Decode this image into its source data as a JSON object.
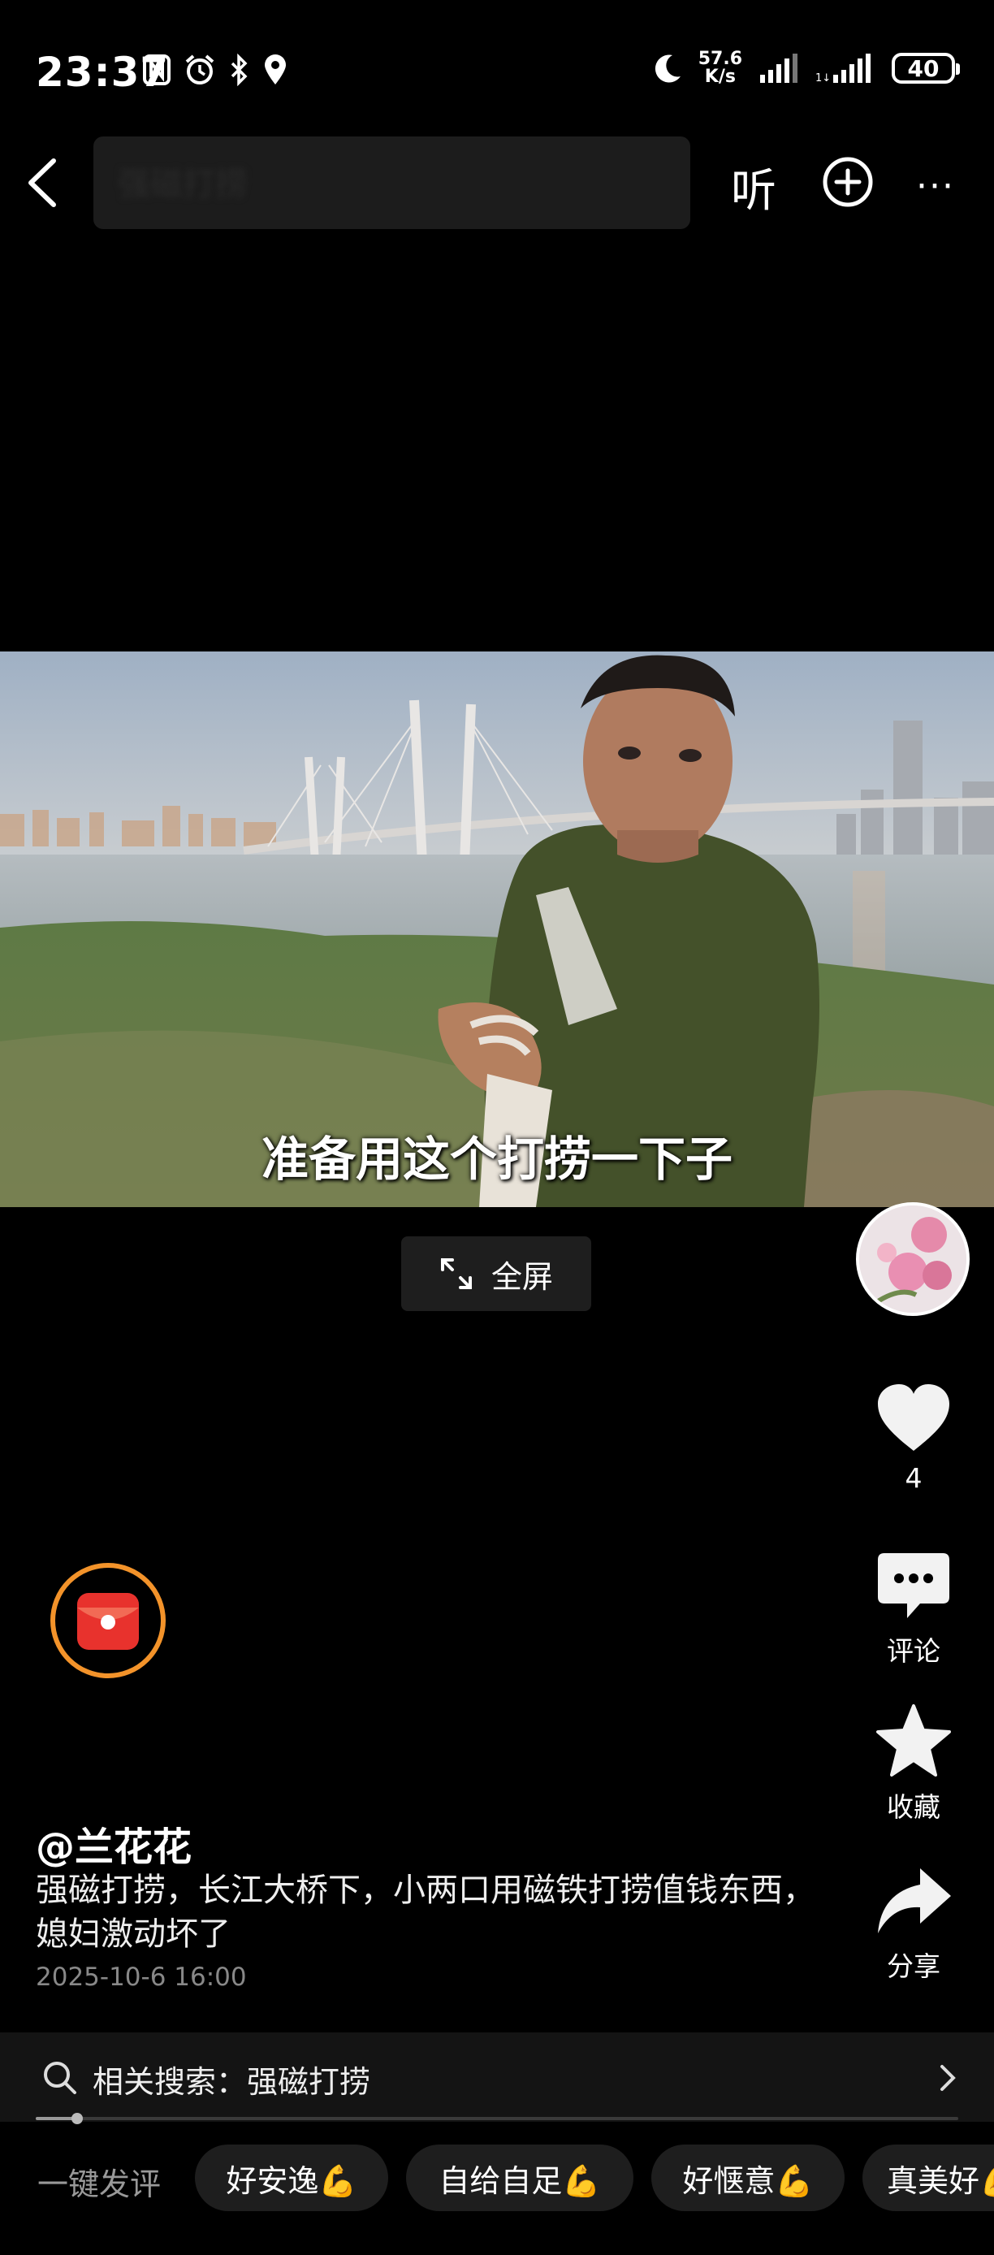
{
  "status_bar": {
    "time": "23:37",
    "net_speed_value": "57.6",
    "net_speed_unit": "K/s",
    "battery": "40"
  },
  "nav": {
    "search_placeholder": "强磁打捞",
    "listen_label": "听"
  },
  "video": {
    "subtitle": "准备用这个打捞一下子",
    "fullscreen_label": "全屏"
  },
  "actions": {
    "like_count": "4",
    "comment_label": "评论",
    "favorite_label": "收藏",
    "share_label": "分享"
  },
  "post": {
    "author": "@兰花花",
    "description": "强磁打捞，长江大桥下，小两口用磁铁打捞值钱东西，媳妇激动坏了",
    "date": "2025-10-6 16:00"
  },
  "related_search": {
    "text": "相关搜索：强磁打捞",
    "progress": 0.045
  },
  "quick_comment": {
    "label": "一键发评",
    "chips": [
      "好安逸💪",
      "自给自足💪",
      "好惬意💪",
      "真美好💪"
    ]
  },
  "colors": {
    "background": "#000000",
    "redpack_ring": "#f3932a",
    "redpack_fill": "#e8322d"
  }
}
